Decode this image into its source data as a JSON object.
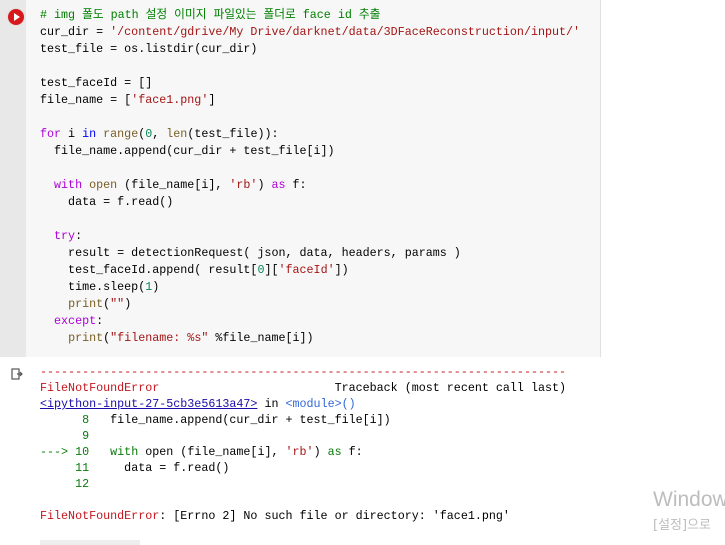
{
  "cell": {
    "run_button": "run-cell",
    "code_lines": [
      [
        [
          "# img 폴도 path 설정 이미지 파일있는 폴더로 face id 추출",
          "cm"
        ]
      ],
      [
        [
          "cur_dir = ",
          ""
        ],
        [
          "'/content/gdrive/My Drive/darknet/data/3DFaceReconstruction/input/'",
          "str"
        ]
      ],
      [
        [
          "test_file = os.listdir(cur_dir)",
          ""
        ]
      ],
      [],
      [
        [
          "test_faceId = []",
          ""
        ]
      ],
      [
        [
          "file_name = [",
          ""
        ],
        [
          "'face1.png'",
          "str"
        ],
        [
          "]",
          ""
        ]
      ],
      [],
      [
        [
          "for",
          "kw"
        ],
        [
          " i ",
          ""
        ],
        [
          "in",
          "in"
        ],
        [
          " ",
          ""
        ],
        [
          "range",
          "bi"
        ],
        [
          "(",
          ""
        ],
        [
          "0",
          "num"
        ],
        [
          ", ",
          ""
        ],
        [
          "len",
          "bi"
        ],
        [
          "(test_file)):",
          ""
        ]
      ],
      [
        [
          "  file_name.append(cur_dir + test_file[i])",
          ""
        ]
      ],
      [],
      [
        [
          "  ",
          ""
        ],
        [
          "with",
          "kw"
        ],
        [
          " ",
          ""
        ],
        [
          "open",
          "bi"
        ],
        [
          " (file_name[i], ",
          ""
        ],
        [
          "'rb'",
          "str"
        ],
        [
          ") ",
          ""
        ],
        [
          "as",
          "kw"
        ],
        [
          " f:",
          ""
        ]
      ],
      [
        [
          "    data = f.read()",
          ""
        ]
      ],
      [],
      [
        [
          "  ",
          ""
        ],
        [
          "try",
          "kw"
        ],
        [
          ":",
          ""
        ]
      ],
      [
        [
          "    result = detectionRequest( json, data, headers, params )",
          ""
        ]
      ],
      [
        [
          "    test_faceId.append( result[",
          ""
        ],
        [
          "0",
          "num"
        ],
        [
          "][",
          ""
        ],
        [
          "'faceId'",
          "str"
        ],
        [
          "])",
          ""
        ]
      ],
      [
        [
          "    time.sleep(",
          ""
        ],
        [
          "1",
          "num"
        ],
        [
          ")",
          ""
        ]
      ],
      [
        [
          "    ",
          ""
        ],
        [
          "print",
          "bi"
        ],
        [
          "(",
          ""
        ],
        [
          "\"\"",
          "str"
        ],
        [
          ")",
          ""
        ]
      ],
      [
        [
          "  ",
          ""
        ],
        [
          "except",
          "kw"
        ],
        [
          ":",
          ""
        ]
      ],
      [
        [
          "    ",
          ""
        ],
        [
          "print",
          "bi"
        ],
        [
          "(",
          ""
        ],
        [
          "\"filename: %s\"",
          "str"
        ],
        [
          " %file_name[i])",
          ""
        ]
      ]
    ]
  },
  "output": {
    "lines": [
      [
        [
          "---------------------------------------------------------------------------",
          "err"
        ]
      ],
      [
        [
          "FileNotFoundError",
          "err"
        ],
        [
          "                         Traceback (most recent call last)",
          ""
        ]
      ],
      [
        [
          "<ipython-input-27-5cb3e5613a47>",
          "link"
        ],
        [
          " in ",
          ""
        ],
        [
          "<module>()",
          "mod"
        ]
      ],
      [
        [
          "      8",
          "lno"
        ],
        [
          "   file_name.append(cur_dir + test_file[i])",
          ""
        ]
      ],
      [
        [
          "      9",
          "lno"
        ]
      ],
      [
        [
          "---> 10",
          "grn"
        ],
        [
          "   ",
          ""
        ],
        [
          "with",
          "grn"
        ],
        [
          " open (file_name[i], ",
          ""
        ],
        [
          "'rb'",
          "str"
        ],
        [
          ") ",
          ""
        ],
        [
          "as",
          "grn"
        ],
        [
          " f:",
          ""
        ]
      ],
      [
        [
          "     11",
          "lno"
        ],
        [
          "     data = f.read()",
          ""
        ]
      ],
      [
        [
          "     12",
          "lno"
        ]
      ],
      [],
      [
        [
          "FileNotFoundError",
          "err"
        ],
        [
          ": [Errno 2] No such file or directory: 'face1.png'",
          ""
        ]
      ]
    ]
  },
  "watermark": {
    "line1": "Window",
    "line2": "[설정]으로"
  }
}
